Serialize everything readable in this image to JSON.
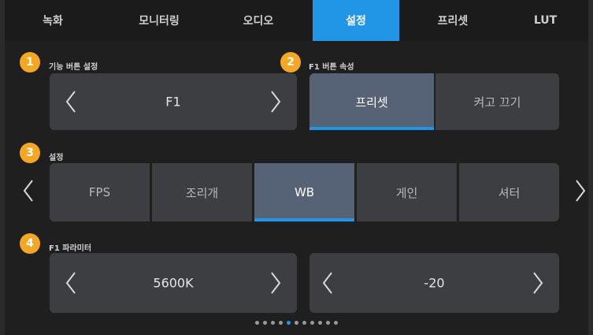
{
  "tabs": [
    {
      "label": "녹화",
      "active": false
    },
    {
      "label": "모니터링",
      "active": false
    },
    {
      "label": "오디오",
      "active": false
    },
    {
      "label": "설정",
      "active": true
    },
    {
      "label": "프리셋",
      "active": false
    },
    {
      "label": "LUT",
      "active": false
    }
  ],
  "sections": {
    "function_button": {
      "number": "1",
      "label": "기능 버튼 설정",
      "value": "F1"
    },
    "button_behavior": {
      "number": "2",
      "label": "F1 버튼 속성",
      "options": [
        "프리셋",
        "켜고 끄기"
      ],
      "selected": "프리셋"
    },
    "setting": {
      "number": "3",
      "label": "설정",
      "options": [
        "FPS",
        "조리개",
        "WB",
        "게인",
        "셔터"
      ],
      "selected": "WB"
    },
    "parameters": {
      "number": "4",
      "label": "F1 파라미터",
      "values": [
        "5600K",
        "-20"
      ]
    }
  },
  "pager": {
    "total": 11,
    "current": 5
  },
  "colors": {
    "accent": "#2196e6",
    "badge": "#f5a623",
    "panel": "#3c3e42",
    "selected": "#566377"
  },
  "icons": [
    "chevron-left-icon",
    "chevron-right-icon"
  ]
}
